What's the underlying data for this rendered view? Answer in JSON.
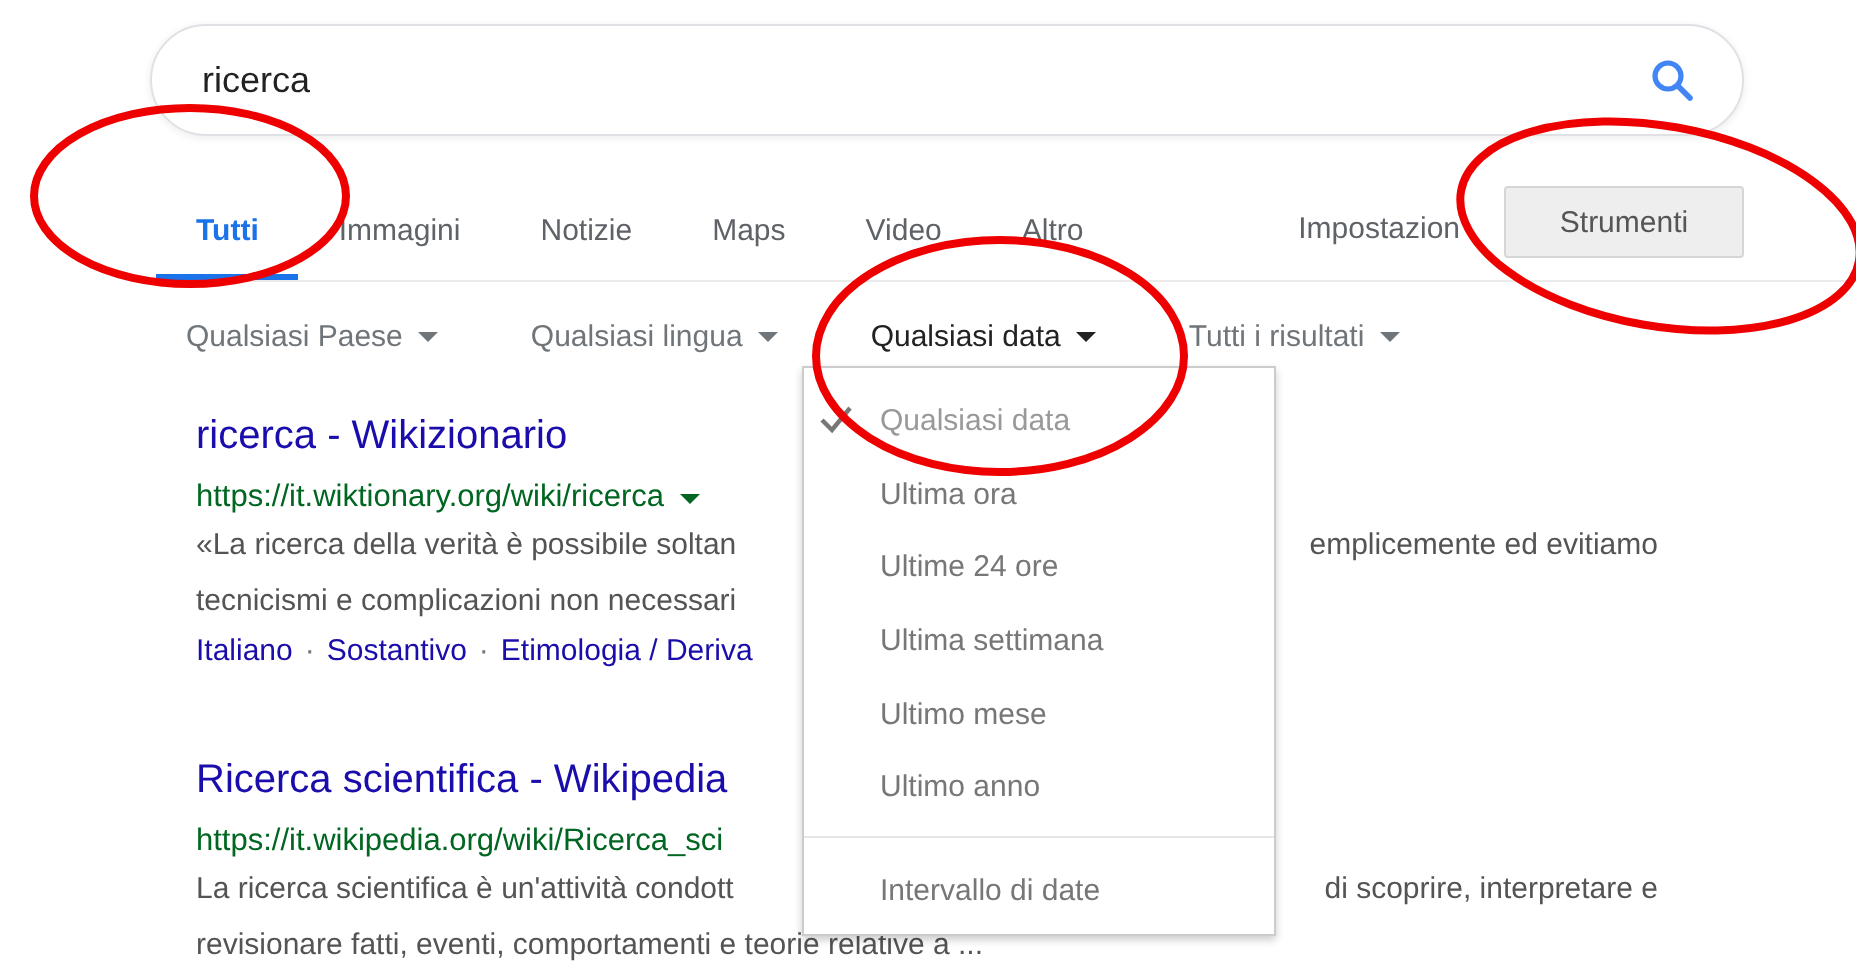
{
  "search": {
    "value": "ricerca"
  },
  "nav": {
    "tabs": [
      {
        "label": "Tutti",
        "selected": true
      },
      {
        "label": "Immagini",
        "selected": false
      },
      {
        "label": "Notizie",
        "selected": false
      },
      {
        "label": "Maps",
        "selected": false
      },
      {
        "label": "Video",
        "selected": false
      },
      {
        "label": "Altro",
        "selected": false
      }
    ],
    "settings": "Impostazion",
    "tools_button": "Strumenti"
  },
  "filters": [
    {
      "label": "Qualsiasi Paese",
      "selected": false
    },
    {
      "label": "Qualsiasi lingua",
      "selected": false
    },
    {
      "label": "Qualsiasi data",
      "selected": true
    },
    {
      "label": "Tutti i risultati",
      "selected": false
    }
  ],
  "date_menu": {
    "items": [
      {
        "label": "Qualsiasi data",
        "selected": true
      },
      {
        "label": "Ultima ora",
        "selected": false
      },
      {
        "label": "Ultime 24 ore",
        "selected": false
      },
      {
        "label": "Ultima settimana",
        "selected": false
      },
      {
        "label": "Ultimo mese",
        "selected": false
      },
      {
        "label": "Ultimo anno",
        "selected": false
      }
    ],
    "custom_range": "Intervallo di date"
  },
  "results": [
    {
      "title": "ricerca - Wikizionario",
      "url": "https://it.wiktionary.org/wiki/ricerca",
      "url_menu": true,
      "snippet_lines": [
        {
          "left": "«La ricerca della verità è possibile soltan",
          "right": "emplicemente ed evitiamo"
        },
        {
          "left": "tecnicismi e complicazioni non necessari"
        }
      ],
      "links": [
        "Italiano",
        "Sostantivo",
        "Etimologia / Deriva"
      ],
      "link_separator": "·"
    },
    {
      "title": "Ricerca scientifica - Wikipedia",
      "url": "https://it.wikipedia.org/wiki/Ricerca_sci",
      "url_menu": false,
      "snippet_lines": [
        {
          "left": "La ricerca scientifica è un'attività condott",
          "right": "di scoprire, interpretare e"
        },
        {
          "left": "revisionare fatti, eventi, comportamenti e teorie relative a ..."
        }
      ]
    }
  ]
}
